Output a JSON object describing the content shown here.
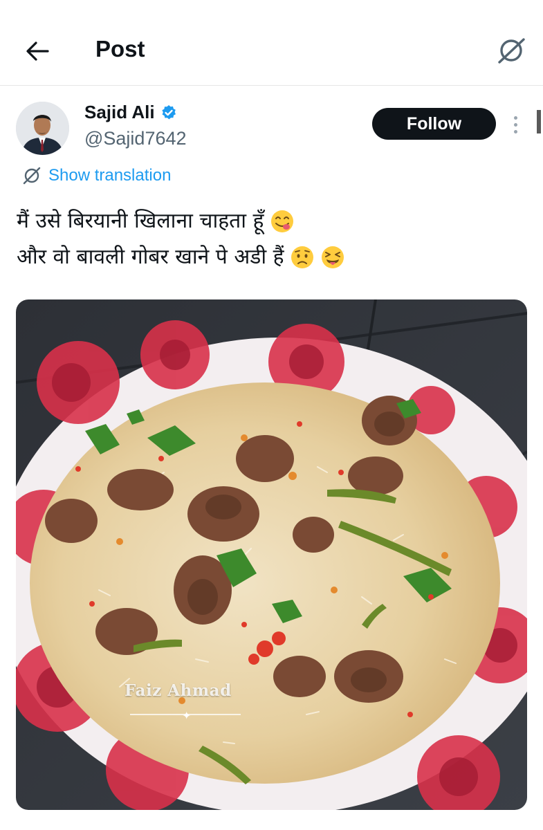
{
  "header": {
    "title": "Post",
    "back_icon": "arrow-left-icon",
    "translate_icon": "translate-slash-icon"
  },
  "author": {
    "display_name": "Sajid Ali",
    "handle": "@Sajid7642",
    "verified": true,
    "verified_color": "#1d9bf0",
    "follow_label": "Follow"
  },
  "post": {
    "show_translation_label": "Show translation",
    "lines": [
      {
        "text": "मैं उसे बिरयानी खिलाना चाहता हूँ",
        "emojis": [
          "yum-face-emoji"
        ]
      },
      {
        "text": "और वो बावली गोबर खाने पे अडी हैं",
        "emojis": [
          "worried-face-emoji",
          "squinting-tongue-emoji"
        ]
      }
    ],
    "media": {
      "description_icon": "biryani-photo",
      "watermark": "Faiz Ahmad"
    }
  },
  "colors": {
    "accent": "#1d9bf0",
    "text": "#0f1419",
    "secondary": "#536471",
    "follow_bg": "#0f1419"
  }
}
